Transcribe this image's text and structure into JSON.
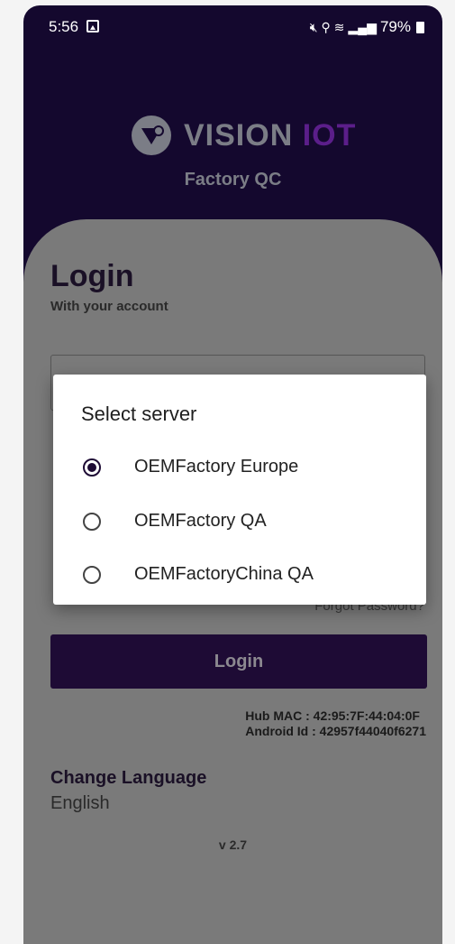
{
  "status_bar": {
    "time": "5:56",
    "battery": "79%",
    "icons": [
      "image-icon",
      "mute-icon",
      "location-icon",
      "wifi-icon",
      "signal-icon",
      "battery-icon"
    ]
  },
  "brand": {
    "logo_word1": "VISION",
    "logo_word2": "IOT",
    "subtitle": "Factory QC",
    "colors": {
      "background": "#14082e",
      "accent": "#5b1e8a",
      "grey": "#7b7d86"
    }
  },
  "login": {
    "title": "Login",
    "subtitle": "With your account",
    "forgot_password": "Forgot Password?",
    "button_label": "Login",
    "hub_mac": "Hub MAC : 42:95:7F:44:04:0F",
    "android_id": "Android Id : 42957f44040f6271",
    "change_language_label": "Change Language",
    "language_value": "English",
    "version": "v 2.7"
  },
  "dialog": {
    "title": "Select server",
    "options": [
      {
        "label": "OEMFactory Europe",
        "selected": true
      },
      {
        "label": "OEMFactory QA",
        "selected": false
      },
      {
        "label": "OEMFactoryChina QA",
        "selected": false
      }
    ]
  }
}
